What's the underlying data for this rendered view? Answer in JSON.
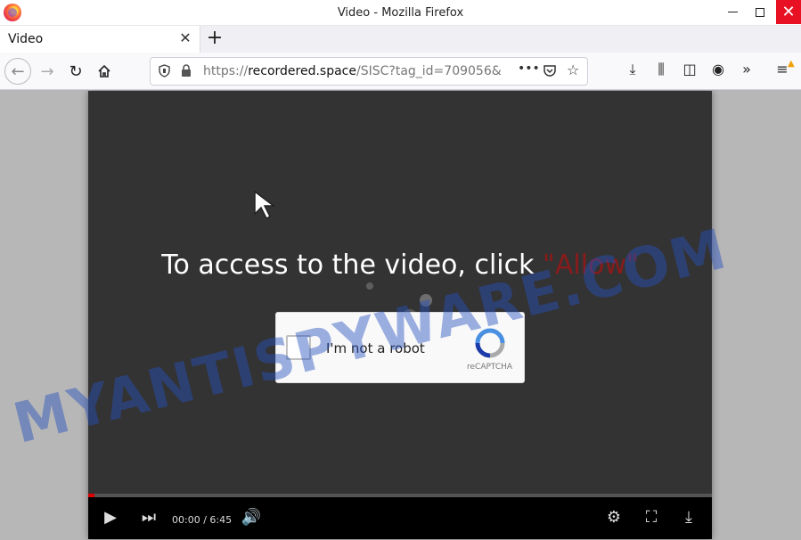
{
  "window": {
    "title": "Video - Mozilla Firefox"
  },
  "tab": {
    "title": "Video"
  },
  "urlbar": {
    "scheme": "https://",
    "domain": "recordered.space",
    "path": "/SISC?tag_id=709056&"
  },
  "player": {
    "headline": "To access to the video, click",
    "headline_allow": "\"Allow\"",
    "captcha_label": "I'm not a robot",
    "captcha_brand": "reCAPTCHA",
    "time": "00:00 / 6:45",
    "progress": 0.01
  },
  "watermark": "MYANTISPYWARE.COM",
  "colors": {
    "close_button": "#e81123",
    "allow_text": "#8a1b1b",
    "progress": "#dd0000",
    "watermark": "#2650be"
  }
}
